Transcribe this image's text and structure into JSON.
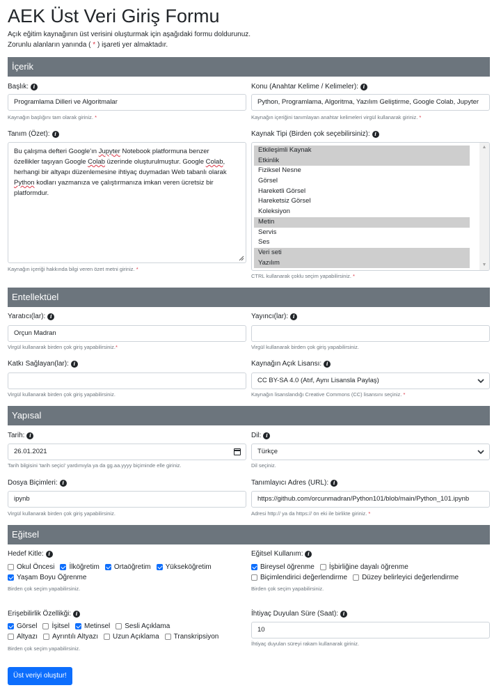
{
  "form_title": "AEK Üst Veri Giriş Formu",
  "intro": {
    "line1": "Açık eğitim kaynağının üst verisini oluşturmak için aşağıdaki formu doldurunuz.",
    "line2_pre": "Zorunlu alanların yanında ( ",
    "line2_star": "*",
    "line2_post": " ) işareti yer almaktadır."
  },
  "sections": {
    "icerik": "İçerik",
    "entellektuel": "Entellektüel",
    "yapisal": "Yapısal",
    "egitsel": "Eğitsel"
  },
  "fields": {
    "baslik": {
      "label": "Başlık:",
      "value": "Programlama Dilleri ve Algoritmalar",
      "help": "Kaynağın başlığını tam olarak giriniz. ",
      "required": "*"
    },
    "konu": {
      "label": "Konu (Anahtar Kelime / Kelimeler):",
      "value": "Python, Programlama, Algoritma, Yazılım Geliştirme, Google Colab, Jupyter",
      "help": "Kaynağın içeriğini tanımlayan anahtar kelimeleri virgül kullanarak giriniz. ",
      "required": "*"
    },
    "tanim": {
      "label": "Tanım (Özet):",
      "value_lines": [
        [
          "Bu çalışma defteri Google'ın ",
          "Jupyter",
          " Notebook platformuna benzer"
        ],
        [
          "özellikler taşıyan Google ",
          "Colab",
          " üzerinde oluşturulmuştur. Google ",
          "Colab",
          ","
        ],
        [
          "herhangi bir altyapı düzenlemesine ihtiyaç duymadan Web tabanlı olarak"
        ],
        [
          "",
          "Python",
          " kodları yazmanıza ve çalıştırmanıza imkan veren ücretsiz bir"
        ],
        [
          "platformdur."
        ]
      ],
      "help": "Kaynağın içeriği hakkında bilgi veren özet metni giriniz. ",
      "required": "*"
    },
    "kaynak_tipi": {
      "label": "Kaynak Tipi (Birden çok seçebilirsiniz):",
      "options": [
        {
          "label": "Etkileşimli Kaynak",
          "selected": true
        },
        {
          "label": "Etkinlik",
          "selected": true
        },
        {
          "label": "Fiziksel Nesne",
          "selected": false
        },
        {
          "label": "Görsel",
          "selected": false
        },
        {
          "label": "Hareketli Görsel",
          "selected": false
        },
        {
          "label": "Hareketsiz Görsel",
          "selected": false
        },
        {
          "label": "Koleksiyon",
          "selected": false
        },
        {
          "label": "Metin",
          "selected": true
        },
        {
          "label": "Servis",
          "selected": false
        },
        {
          "label": "Ses",
          "selected": false
        },
        {
          "label": "Veri seti",
          "selected": true
        },
        {
          "label": "Yazılım",
          "selected": true
        }
      ],
      "help": "CTRL kullanarak çoklu seçim yapabilirsiniz. ",
      "required": "*"
    },
    "yaratici": {
      "label": "Yaratıcı(lar):",
      "value": "Orçun Madran",
      "help": "Virgül kullanarak birden çok giriş yapabilirsiniz.",
      "required": "*"
    },
    "yayinci": {
      "label": "Yayıncı(lar):",
      "value": "",
      "help": "Virgül kullanarak birden çok giriş yapabilirsiniz."
    },
    "katki": {
      "label": "Katkı Sağlayan(lar):",
      "value": "",
      "help": "Virgül kullanarak birden çok giriş yapabilirsiniz."
    },
    "lisans": {
      "label": "Kaynağın Açık Lisansı:",
      "value": "CC BY-SA 4.0 (Atıf, Aynı Lisansla Paylaş)",
      "help": "Kaynağın lisanslandığı Creative Commons (CC) lisansını seçiniz. ",
      "required": "*"
    },
    "tarih": {
      "label": "Tarih:",
      "value": "26.01.2021",
      "help": "Tarih bilgisini 'tarih seçici' yardımıyla ya da gg.aa.yyyy biçiminde elle giriniz."
    },
    "dil": {
      "label": "Dil:",
      "value": "Türkçe",
      "help": "Dil seçiniz."
    },
    "dosya": {
      "label": "Dosya Biçimleri:",
      "value": "ipynb",
      "help": "Virgül kullanarak birden çok giriş yapabilirsiniz."
    },
    "url": {
      "label": "Tanımlayıcı Adres (URL):",
      "value": "https://github.com/orcunmadran/Python101/blob/main/Python_101.ipynb",
      "help": "Adresi http:// ya da https:// ön eki ile birlikte giriniz. ",
      "required": "*"
    },
    "hedef_kitle": {
      "label": "Hedef Kitle:",
      "options": [
        {
          "label": "Okul Öncesi",
          "checked": false
        },
        {
          "label": "İlköğretim",
          "checked": true
        },
        {
          "label": "Ortaöğretim",
          "checked": true
        },
        {
          "label": "Yükseköğretim",
          "checked": true
        },
        {
          "label": "Yaşam Boyu Öğrenme",
          "checked": true
        }
      ],
      "help": "Birden çok seçim yapabilirsiniz."
    },
    "egitsel_kullanim": {
      "label": "Eğitsel Kullanım:",
      "options": [
        {
          "label": "Bireysel öğrenme",
          "checked": true
        },
        {
          "label": "İşbirliğine dayalı öğrenme",
          "checked": false
        },
        {
          "label": "Biçimlendirici değerlendirme",
          "checked": false
        },
        {
          "label": "Düzey belirleyici değerlendirme",
          "checked": false
        }
      ],
      "help": "Birden çok seçim yapabilirsiniz."
    },
    "erisilebilirlik": {
      "label": "Erişebilirlik Özellikği:",
      "options": [
        {
          "label": "Görsel",
          "checked": true
        },
        {
          "label": "İşitsel",
          "checked": false
        },
        {
          "label": "Metinsel",
          "checked": true
        },
        {
          "label": "Sesli Açıklama",
          "checked": false
        },
        {
          "label": "Altyazı",
          "checked": false
        },
        {
          "label": "Ayrıntılı Altyazı",
          "checked": false
        },
        {
          "label": "Uzun Açıklama",
          "checked": false
        },
        {
          "label": "Transkripsiyon",
          "checked": false
        }
      ],
      "help": "Birden çok seçim yapabilirsiniz."
    },
    "sure": {
      "label": "İhtiyaç Duyulan Süre (Saat):",
      "value": "10",
      "help": "İhtiyaç duyulan süreyi rakam kullanarak giriniz."
    }
  },
  "submit_label": "Üst veriyi oluştur!",
  "icons": {
    "info": "info-circle-icon",
    "chevron": "chevron-down-icon",
    "calendar": "calendar-icon"
  },
  "colors": {
    "section_bar": "#6c757d",
    "primary": "#0d6efd",
    "required": "#dc3545",
    "selected_option": "#cecece"
  }
}
